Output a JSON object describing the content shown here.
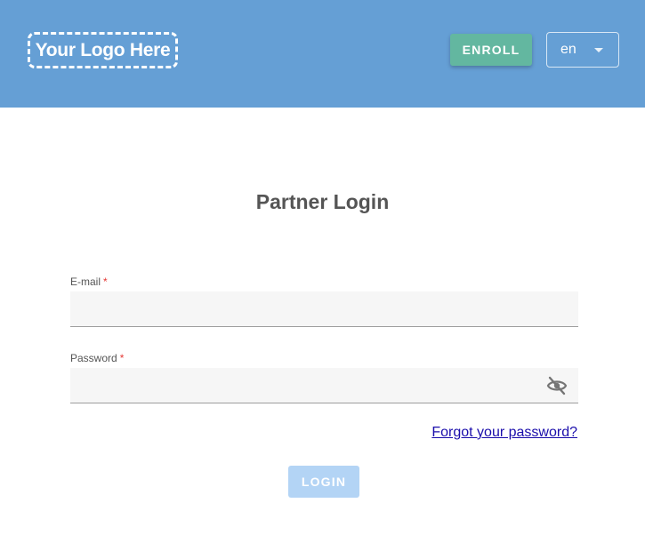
{
  "header": {
    "logo_text": "Your Logo Here",
    "enroll_label": "ENROLL",
    "language": {
      "selected": "en"
    },
    "colors": {
      "background": "#659fd5",
      "enroll_button": "#63b7a0"
    }
  },
  "main": {
    "title": "Partner Login",
    "email": {
      "label": "E-mail",
      "required_mark": "*",
      "value": ""
    },
    "password": {
      "label": "Password",
      "required_mark": "*",
      "value": "",
      "toggle_icon": "eye-off-icon"
    },
    "forgot_password": "Forgot your password?",
    "login_label": "LOGIN",
    "colors": {
      "required": "#e53935",
      "link": "#1a0dab",
      "login_button_disabled": "#b3d4f5"
    }
  }
}
